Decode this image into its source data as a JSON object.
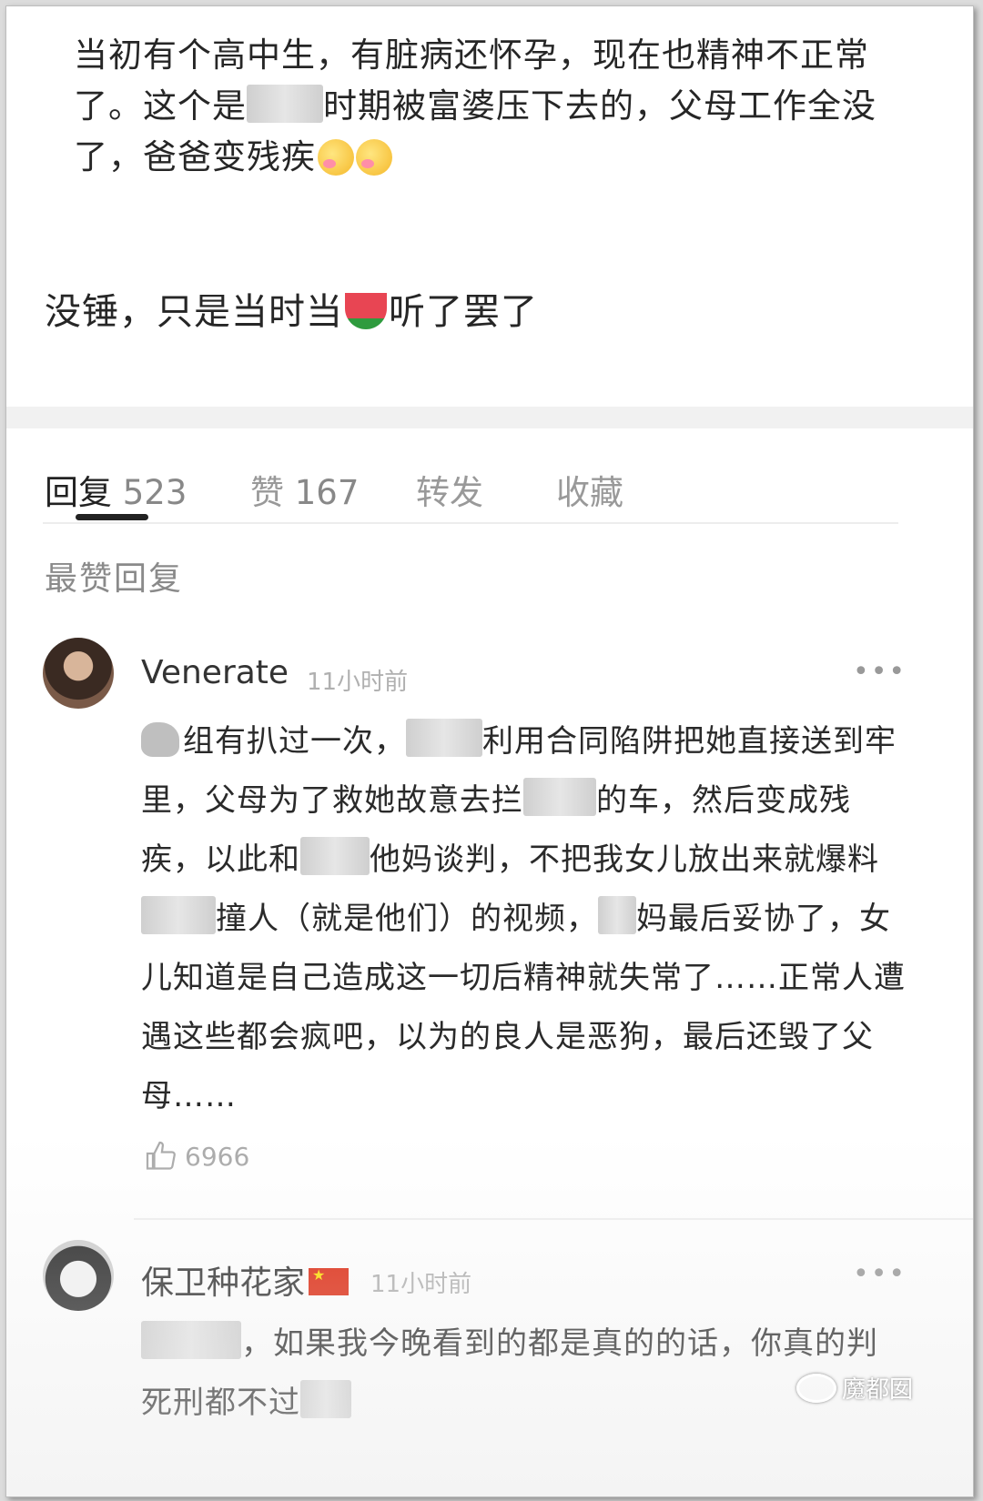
{
  "post": {
    "line1_a": "当初有个高中生，有脏病还怀孕，现在也精神不正常了。这个是",
    "line1_b": "时期被富婆压下去的，父母工作全没了，爸爸变残疾",
    "line2_a": "没锤，只是当时当",
    "line2_b": "听了罢了"
  },
  "tabs": [
    {
      "label": "回复",
      "count": "523"
    },
    {
      "label": "赞",
      "count": "167"
    },
    {
      "label": "转发",
      "count": ""
    },
    {
      "label": "收藏",
      "count": ""
    }
  ],
  "section_title": "最赞回复",
  "comments": [
    {
      "username": "Venerate",
      "time": "11小时前",
      "more": "•••",
      "text_parts": [
        "组有扒过一次，",
        "利用合同陷阱把她直接送到牢里，父母为了救她故意去拦",
        "的车，然后变成残疾，以此和",
        "他妈谈判，不把我女儿放出来就爆料",
        "撞人（就是他们）的视频，",
        "妈最后妥协了，女儿知道是自己造成这一切后精神就失常了……正常人遭遇这些都会疯吧，以为的良人是恶狗，最后还毁了父母……"
      ],
      "likes": "6966"
    },
    {
      "username": "保卫种花家",
      "time": "11小时前",
      "more": "•••",
      "text_parts": [
        "，如果我今晚看到的都是真的的话，你真的判死刑都不过"
      ]
    }
  ],
  "watermark": "魔都囡"
}
